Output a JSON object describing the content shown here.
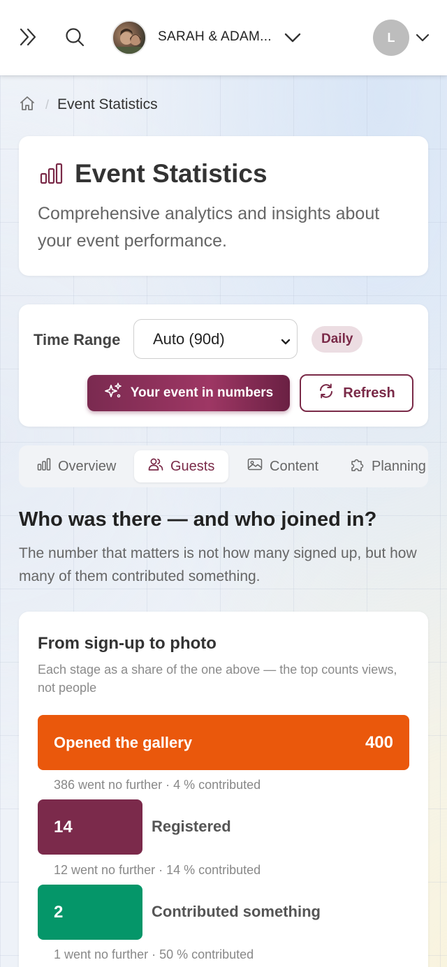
{
  "header": {
    "event_name": "SARAH & ADAM...",
    "user_initial": "L"
  },
  "breadcrumb": {
    "current": "Event Statistics"
  },
  "page": {
    "title": "Event Statistics",
    "subtitle": "Comprehensive analytics and insights about your event performance."
  },
  "controls": {
    "time_range_label": "Time Range",
    "time_range_value": "Auto (90d)",
    "granularity_badge": "Daily",
    "primary_button": "Your event in numbers",
    "refresh_button": "Refresh"
  },
  "tabs": [
    {
      "label": "Overview",
      "icon": "bar-chart-icon",
      "active": false
    },
    {
      "label": "Guests",
      "icon": "users-icon",
      "active": true
    },
    {
      "label": "Content",
      "icon": "image-icon",
      "active": false
    },
    {
      "label": "Planning",
      "icon": "puzzle-icon",
      "active": false
    }
  ],
  "section": {
    "title": "Who was there — and who joined in?",
    "description": "The number that matters is not how many signed up, but how many of them contributed something."
  },
  "funnel": {
    "title": "From sign-up to photo",
    "description": "Each stage as a share of the one above — the top counts views, not people",
    "stages": [
      {
        "label": "Opened the gallery",
        "value": "400",
        "color": "#ea580c",
        "note": "386 went no further · 4 % contributed"
      },
      {
        "label": "Registered",
        "value": "14",
        "color": "#7b2a4b",
        "note": "12 went no further · 14 % contributed"
      },
      {
        "label": "Contributed something",
        "value": "2",
        "color": "#059669",
        "note": "1 went no further · 50 % contributed"
      }
    ]
  },
  "colors": {
    "brand": "#7a2a48",
    "accent_bar_icon": "#7a2a48"
  }
}
